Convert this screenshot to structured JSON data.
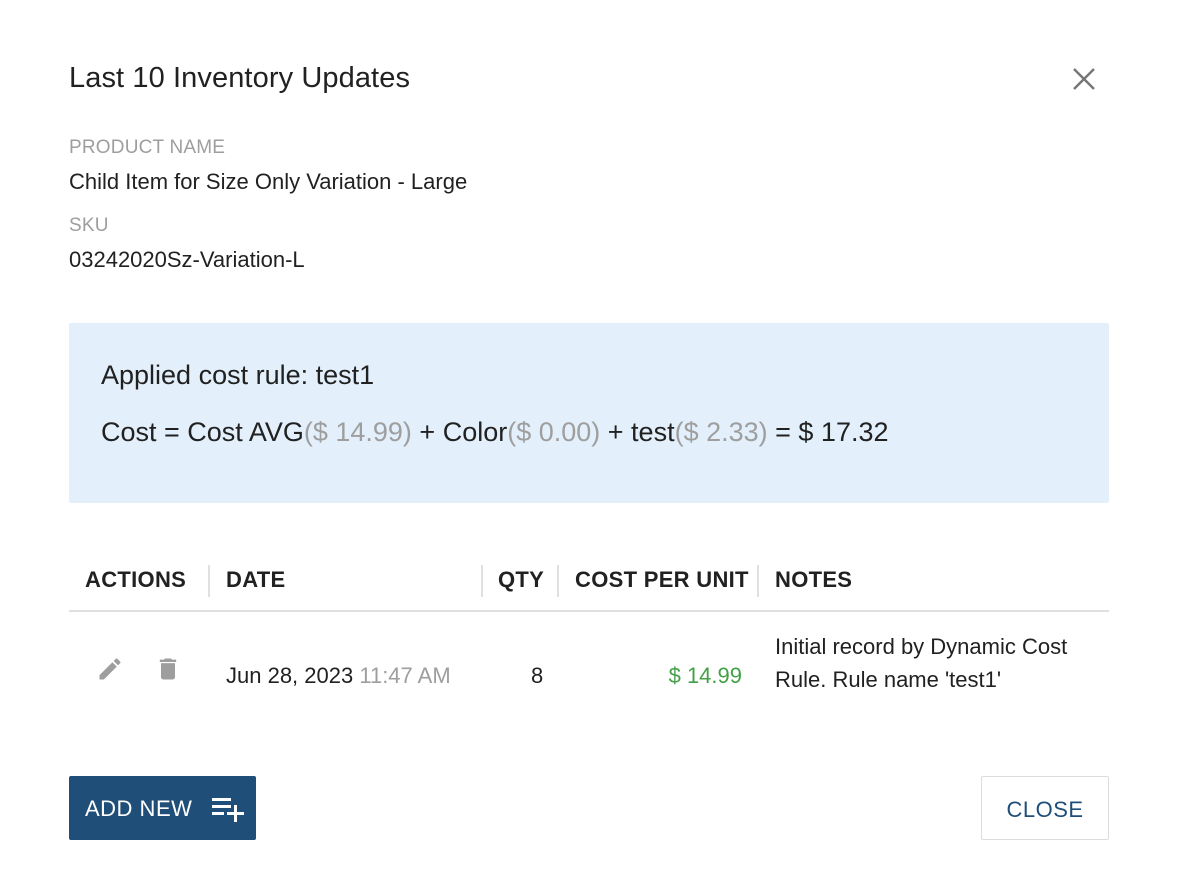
{
  "dialog": {
    "title": "Last 10 Inventory Updates",
    "close_icon": "close-icon"
  },
  "product": {
    "name_label": "PRODUCT NAME",
    "name_value": "Child Item for Size Only Variation - Large",
    "sku_label": "SKU",
    "sku_value": "03242020Sz-Variation-L"
  },
  "cost_rule": {
    "title": "Applied cost rule: test1",
    "formula": {
      "prefix": "Cost = Cost AVG",
      "avg_value": "($ 14.99)",
      "plus1": " + Color",
      "color_value": "($ 0.00)",
      "plus2": " + test",
      "test_value": "($ 2.33)",
      "result": " = $ 17.32"
    },
    "background": "#e3f0fb"
  },
  "table": {
    "headers": {
      "actions": "ACTIONS",
      "date": "DATE",
      "qty": "QTY",
      "cost_per_unit": "COST PER UNIT",
      "notes": "NOTES"
    },
    "rows": [
      {
        "date": "Jun 28, 2023",
        "time": "11:47 AM",
        "qty": "8",
        "cost_per_unit": "$ 14.99",
        "notes_line1": "Initial record by Dynamic Cost",
        "notes_line2": "Rule. Rule name 'test1'",
        "edit_icon": "pencil-icon",
        "delete_icon": "trash-icon"
      }
    ]
  },
  "footer": {
    "add_new_label": "ADD NEW",
    "add_new_icon": "playlist-add-icon",
    "close_label": "CLOSE"
  },
  "colors": {
    "primary": "#1f4e79",
    "cost_positive": "#43a047",
    "muted": "#9e9e9e"
  }
}
